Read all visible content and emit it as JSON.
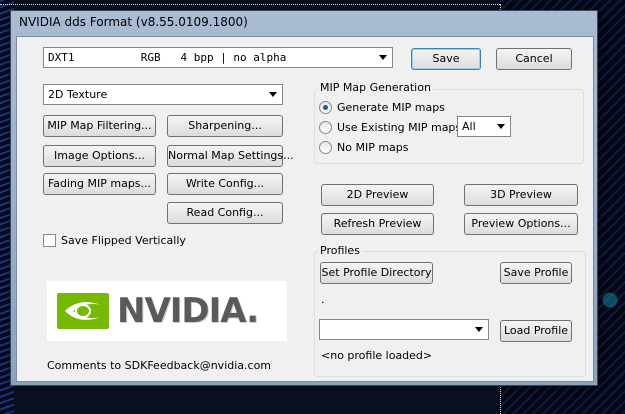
{
  "window": {
    "title": "NVIDIA dds Format (v8.55.0109.1800)"
  },
  "format": {
    "selected": "DXT1          RGB   4 bpp | no alpha"
  },
  "texture_type": {
    "selected": "2D Texture"
  },
  "buttons": {
    "save": "Save",
    "cancel": "Cancel",
    "mip_map_filtering": "MIP Map Filtering...",
    "sharpening": "Sharpening...",
    "image_options": "Image Options...",
    "normal_map_settings": "Normal Map Settings...",
    "fading_mip_maps": "Fading MIP maps...",
    "write_config": "Write Config...",
    "read_config": "Read Config...",
    "preview_2d": "2D Preview",
    "preview_3d": "3D Preview",
    "refresh_preview": "Refresh Preview",
    "preview_options": "Preview Options...",
    "set_profile_directory": "Set Profile Directory",
    "save_profile": "Save Profile",
    "load_profile": "Load Profile"
  },
  "mip_generation": {
    "title": "MIP Map Generation",
    "options": [
      "Generate MIP maps",
      "Use Existing MIP maps",
      "No MIP maps"
    ],
    "selected_index": 0,
    "existing_select": "All"
  },
  "save_flipped": {
    "label": "Save Flipped Vertically",
    "checked": false
  },
  "logo": {
    "text": "NVIDIA."
  },
  "comments": "Comments to SDKFeedback@nvidia.com",
  "profiles": {
    "title": "Profiles",
    "dot_label": ".",
    "combo_value": "",
    "status": "<no profile loaded>"
  },
  "colors": {
    "nvidia_green": "#76b900",
    "logo_gray": "#5a5a5a"
  }
}
